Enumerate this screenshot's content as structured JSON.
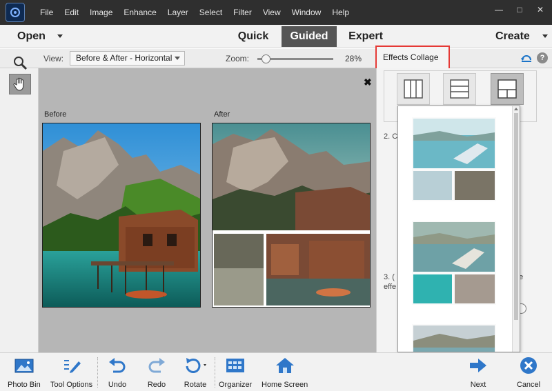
{
  "menu": [
    "File",
    "Edit",
    "Image",
    "Enhance",
    "Layer",
    "Select",
    "Filter",
    "View",
    "Window",
    "Help"
  ],
  "window_controls": {
    "minimize": "—",
    "maximize": "□",
    "close": "✕"
  },
  "modebar": {
    "open_label": "Open",
    "tabs": [
      {
        "label": "Quick",
        "active": false
      },
      {
        "label": "Guided",
        "active": true
      },
      {
        "label": "Expert",
        "active": false
      }
    ],
    "create_label": "Create"
  },
  "options": {
    "view_label": "View:",
    "view_value": "Before & After - Horizontal",
    "zoom_label": "Zoom:",
    "zoom_value": "28%",
    "zoom_fraction": 0.06,
    "panel_title": "Effects Collage",
    "help_glyph": "?"
  },
  "canvas": {
    "close_glyph": "✖",
    "before_label": "Before",
    "after_label": "After"
  },
  "panel": {
    "step2_peek": "2. C",
    "step3_peek": "3. (",
    "step3_line2_peek": "effe",
    "step3_right_peek": "he",
    "layout_selected_index": 2
  },
  "bottom": {
    "buttons": [
      {
        "label": "Photo Bin",
        "icon": "photo-bin-icon"
      },
      {
        "label": "Tool Options",
        "icon": "tool-options-icon"
      },
      {
        "label": "Undo",
        "icon": "undo-icon"
      },
      {
        "label": "Redo",
        "icon": "redo-icon"
      },
      {
        "label": "Rotate",
        "icon": "rotate-icon"
      },
      {
        "label": "Organizer",
        "icon": "organizer-icon"
      },
      {
        "label": "Home Screen",
        "icon": "home-icon"
      },
      {
        "label": "Next",
        "icon": "next-arrow-icon"
      },
      {
        "label": "Cancel",
        "icon": "cancel-icon"
      }
    ]
  },
  "colors": {
    "titlebar": "#2f2f2f",
    "accent_blue": "#1b74c8",
    "highlight_red": "#e53935",
    "active_tab": "#555555"
  }
}
